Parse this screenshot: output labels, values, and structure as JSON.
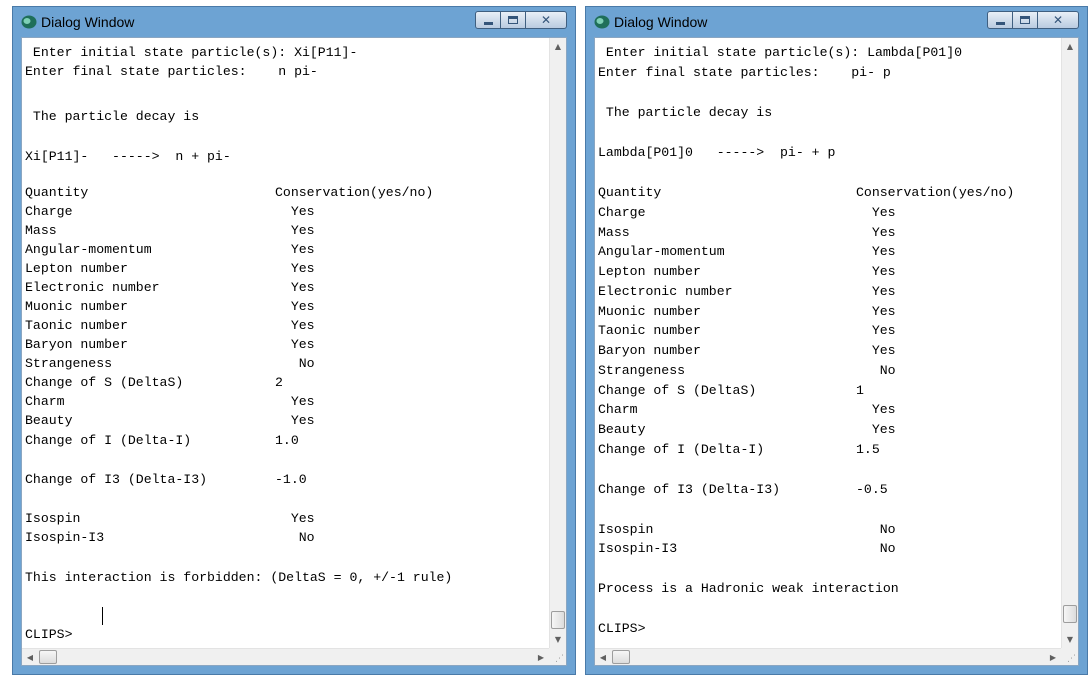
{
  "windows": [
    {
      "title": "Dialog Window",
      "prompt_line": " Enter initial state particle(s): Xi[P11]-",
      "final_line": "Enter final state particles:    n pi-",
      "decay_header": " The particle decay is",
      "decay": "Xi[P11]-   ----->  n + pi-",
      "table_header": {
        "quantity": "Quantity",
        "conservation": "Conservation(yes/no)"
      },
      "rows": [
        {
          "q": "Charge",
          "v": "  Yes"
        },
        {
          "q": "Mass",
          "v": "  Yes"
        },
        {
          "q": "Angular-momentum",
          "v": "  Yes"
        },
        {
          "q": "Lepton number",
          "v": "  Yes"
        },
        {
          "q": "Electronic number",
          "v": "  Yes"
        },
        {
          "q": "Muonic number",
          "v": "  Yes"
        },
        {
          "q": "Taonic number",
          "v": "  Yes"
        },
        {
          "q": "Baryon number",
          "v": "  Yes"
        },
        {
          "q": "Strangeness",
          "v": "   No"
        },
        {
          "q": "Change of S (DeltaS)",
          "v": "2"
        },
        {
          "q": "Charm",
          "v": "  Yes"
        },
        {
          "q": "Beauty",
          "v": "  Yes"
        },
        {
          "q": "Change of I (Delta-I)",
          "v": "1.0"
        }
      ],
      "i3_row": {
        "q": "Change of I3 (Delta-I3)",
        "v": "-1.0"
      },
      "iso_rows": [
        {
          "q": "Isospin",
          "v": "  Yes"
        },
        {
          "q": "Isospin-I3",
          "v": "   No"
        }
      ],
      "result": "This interaction is forbidden: (DeltaS = 0, +/-1 rule)",
      "clips_prompt": "CLIPS>"
    },
    {
      "title": "Dialog Window",
      "prompt_line": " Enter initial state particle(s): Lambda[P01]0",
      "final_line": "Enter final state particles:    pi- p",
      "decay_header": " The particle decay is",
      "decay": "Lambda[P01]0   ----->  pi- + p",
      "table_header": {
        "quantity": "Quantity",
        "conservation": "Conservation(yes/no)"
      },
      "rows": [
        {
          "q": "Charge",
          "v": "  Yes"
        },
        {
          "q": "Mass",
          "v": "  Yes"
        },
        {
          "q": "Angular-momentum",
          "v": "  Yes"
        },
        {
          "q": "Lepton number",
          "v": "  Yes"
        },
        {
          "q": "Electronic number",
          "v": "  Yes"
        },
        {
          "q": "Muonic number",
          "v": "  Yes"
        },
        {
          "q": "Taonic number",
          "v": "  Yes"
        },
        {
          "q": "Baryon number",
          "v": "  Yes"
        },
        {
          "q": "Strangeness",
          "v": "   No"
        },
        {
          "q": "Change of S (DeltaS)",
          "v": "1"
        },
        {
          "q": "Charm",
          "v": "  Yes"
        },
        {
          "q": "Beauty",
          "v": "  Yes"
        },
        {
          "q": "Change of I (Delta-I)",
          "v": "1.5"
        }
      ],
      "i3_row": {
        "q": "Change of I3 (Delta-I3)",
        "v": "-0.5"
      },
      "iso_rows": [
        {
          "q": "Isospin",
          "v": "   No"
        },
        {
          "q": "Isospin-I3",
          "v": "   No"
        }
      ],
      "result": "Process is a Hadronic weak interaction",
      "clips_prompt": "CLIPS>"
    }
  ],
  "colors": {
    "window_frame": "#6da3d3",
    "console_bg": "#ffffff",
    "text": "#000000"
  },
  "icons": {
    "app": "clips-app-icon",
    "minimize": "minimize-icon",
    "maximize": "maximize-icon",
    "close": "close-icon"
  }
}
